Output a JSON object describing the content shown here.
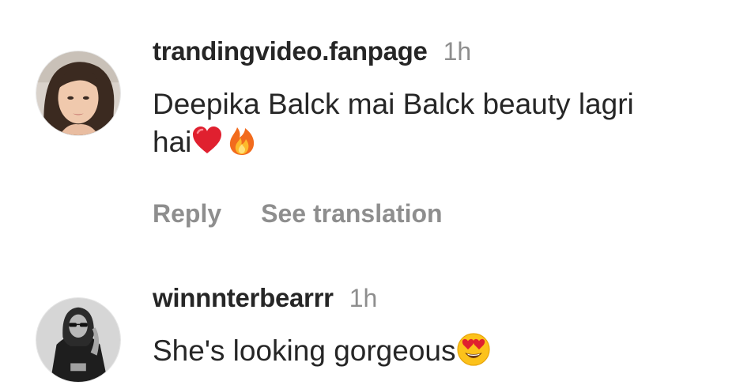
{
  "comments": [
    {
      "username": "trandingvideo.fanpage",
      "time": "1h",
      "text": "Deepika Balck mai Balck beauty lagri",
      "text_line2": "hai",
      "emojis": [
        "red-heart-icon",
        "fire-icon"
      ],
      "reply_label": "Reply",
      "translate_label": "See translation"
    },
    {
      "username": "winnnterbearrr",
      "time": "1h",
      "text": "She's looking gorgeous",
      "emojis": [
        "heart-eyes-face-icon"
      ]
    }
  ],
  "colors": {
    "text": "#262626",
    "muted": "#8e8e8e",
    "background": "#ffffff"
  }
}
